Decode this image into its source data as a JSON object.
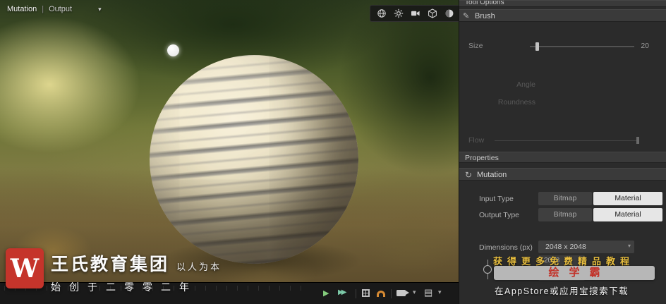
{
  "viewport": {
    "breadcrumb": {
      "primary": "Mutation",
      "separator": "|",
      "secondary": "Output"
    },
    "toolbar_icons": [
      "globe",
      "display-settings",
      "camera",
      "cube",
      "environment-sphere"
    ]
  },
  "tool_options": {
    "title": "Tool Options",
    "brush_title": "Brush",
    "size_label": "Size",
    "size_value": "20",
    "angle_label": "Angle",
    "roundness_label": "Roundness",
    "flow_label": "Flow"
  },
  "properties": {
    "title": "Properties",
    "group_title": "Mutation",
    "input_type_label": "Input Type",
    "output_type_label": "Output Type",
    "type_options": [
      "Bitmap",
      "Material"
    ],
    "input_selected": "Material",
    "output_selected": "Material",
    "dimensions_label": "Dimensions (px)",
    "dimensions_value": "2048 x 2048",
    "width_value": "2048",
    "height_value": "2048"
  },
  "timeline": {
    "icons": [
      "play",
      "fast-forward",
      "grid",
      "magnet",
      "camera",
      "chevron-down",
      "clapper",
      "chevron-down"
    ]
  },
  "watermark": {
    "logo_letter": "W",
    "company": "王氏教育集团",
    "slogan": "以人为本",
    "founded_line": "始创于二零零二年"
  },
  "promo": {
    "headline": "获得更多免费精品教程",
    "brand": "绘学霸",
    "footer": "在AppStore或应用宝搜索下载"
  },
  "colors": {
    "brand_red": "#c5342b",
    "promo_yellow": "#e7bd3e",
    "selected_button_bg": "#e6e6e6",
    "play_green": "#84cb7c",
    "magnet_orange": "#d68a33"
  }
}
